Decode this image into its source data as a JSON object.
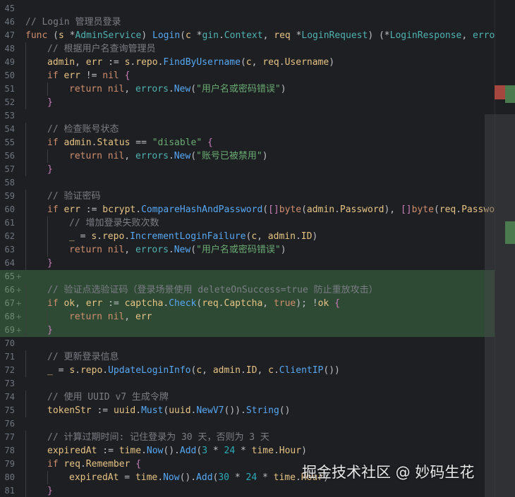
{
  "editor": {
    "lines": [
      {
        "n": "45",
        "added": false,
        "indent": 0,
        "t": []
      },
      {
        "n": "46",
        "added": false,
        "indent": 0,
        "t": [
          [
            "cm",
            "// Login 管理员登录"
          ]
        ]
      },
      {
        "n": "47",
        "added": false,
        "indent": 0,
        "t": [
          [
            "kw",
            "func"
          ],
          [
            "op",
            " ("
          ],
          [
            "vr",
            "s"
          ],
          [
            "op",
            " *"
          ],
          [
            "ty",
            "AdminService"
          ],
          [
            "op",
            ") "
          ],
          [
            "fn",
            "Login"
          ],
          [
            "op",
            "("
          ],
          [
            "vr",
            "c"
          ],
          [
            "op",
            " *"
          ],
          [
            "ty",
            "gin"
          ],
          [
            "op",
            "."
          ],
          [
            "ty",
            "Context"
          ],
          [
            "op",
            ", "
          ],
          [
            "vr",
            "req"
          ],
          [
            "op",
            " *"
          ],
          [
            "ty",
            "LoginRequest"
          ],
          [
            "op",
            ") (*"
          ],
          [
            "ty",
            "LoginResponse"
          ],
          [
            "op",
            ", "
          ],
          [
            "ty",
            "error"
          ],
          [
            "op",
            ")"
          ]
        ]
      },
      {
        "n": "48",
        "added": false,
        "indent": 1,
        "t": [
          [
            "cm",
            "// 根据用户名查询管理员"
          ]
        ]
      },
      {
        "n": "49",
        "added": false,
        "indent": 1,
        "t": [
          [
            "vr",
            "admin"
          ],
          [
            "op",
            ", "
          ],
          [
            "vr",
            "err"
          ],
          [
            "op",
            " := "
          ],
          [
            "vr",
            "s"
          ],
          [
            "op",
            "."
          ],
          [
            "vr",
            "repo"
          ],
          [
            "op",
            "."
          ],
          [
            "fn",
            "FindByUsername"
          ],
          [
            "op",
            "("
          ],
          [
            "vr",
            "c"
          ],
          [
            "op",
            ", "
          ],
          [
            "vr",
            "req"
          ],
          [
            "op",
            "."
          ],
          [
            "vr",
            "Username"
          ],
          [
            "op",
            ")"
          ]
        ]
      },
      {
        "n": "50",
        "added": false,
        "indent": 1,
        "t": [
          [
            "kw",
            "if"
          ],
          [
            "op",
            " "
          ],
          [
            "vr",
            "err"
          ],
          [
            "op",
            " != "
          ],
          [
            "kw",
            "nil"
          ],
          [
            "op",
            " "
          ],
          [
            "pr",
            "{"
          ]
        ]
      },
      {
        "n": "51",
        "added": false,
        "indent": 2,
        "t": [
          [
            "kw",
            "return"
          ],
          [
            "op",
            " "
          ],
          [
            "kw",
            "nil"
          ],
          [
            "op",
            ", "
          ],
          [
            "ty",
            "errors"
          ],
          [
            "op",
            "."
          ],
          [
            "fn",
            "New"
          ],
          [
            "op",
            "("
          ],
          [
            "str",
            "\"用户名或密码错误\""
          ],
          [
            "op",
            ")"
          ]
        ]
      },
      {
        "n": "52",
        "added": false,
        "indent": 1,
        "t": [
          [
            "pr",
            "}"
          ]
        ]
      },
      {
        "n": "53",
        "added": false,
        "indent": 0,
        "t": []
      },
      {
        "n": "54",
        "added": false,
        "indent": 1,
        "t": [
          [
            "cm",
            "// 检查账号状态"
          ]
        ]
      },
      {
        "n": "55",
        "added": false,
        "indent": 1,
        "t": [
          [
            "kw",
            "if"
          ],
          [
            "op",
            " "
          ],
          [
            "vr",
            "admin"
          ],
          [
            "op",
            "."
          ],
          [
            "vr",
            "Status"
          ],
          [
            "op",
            " == "
          ],
          [
            "str",
            "\"disable\""
          ],
          [
            "op",
            " "
          ],
          [
            "pr",
            "{"
          ]
        ]
      },
      {
        "n": "56",
        "added": false,
        "indent": 2,
        "t": [
          [
            "kw",
            "return"
          ],
          [
            "op",
            " "
          ],
          [
            "kw",
            "nil"
          ],
          [
            "op",
            ", "
          ],
          [
            "ty",
            "errors"
          ],
          [
            "op",
            "."
          ],
          [
            "fn",
            "New"
          ],
          [
            "op",
            "("
          ],
          [
            "str",
            "\"账号已被禁用\""
          ],
          [
            "op",
            ")"
          ]
        ]
      },
      {
        "n": "57",
        "added": false,
        "indent": 1,
        "t": [
          [
            "pr",
            "}"
          ]
        ]
      },
      {
        "n": "58",
        "added": false,
        "indent": 0,
        "t": []
      },
      {
        "n": "59",
        "added": false,
        "indent": 1,
        "t": [
          [
            "cm",
            "// 验证密码"
          ]
        ]
      },
      {
        "n": "60",
        "added": false,
        "indent": 1,
        "t": [
          [
            "kw",
            "if"
          ],
          [
            "op",
            " "
          ],
          [
            "vr",
            "err"
          ],
          [
            "op",
            " := "
          ],
          [
            "vr",
            "bcrypt"
          ],
          [
            "op",
            "."
          ],
          [
            "fn",
            "CompareHashAndPassword"
          ],
          [
            "op",
            "("
          ],
          [
            "pr",
            "[]"
          ],
          [
            "kw",
            "byte"
          ],
          [
            "op",
            "("
          ],
          [
            "vr",
            "admin"
          ],
          [
            "op",
            "."
          ],
          [
            "vr",
            "Password"
          ],
          [
            "op",
            "), "
          ],
          [
            "pr",
            "[]"
          ],
          [
            "kw",
            "byte"
          ],
          [
            "op",
            "("
          ],
          [
            "vr",
            "req"
          ],
          [
            "op",
            "."
          ],
          [
            "vr",
            "Password"
          ],
          [
            "op",
            "))"
          ]
        ]
      },
      {
        "n": "61",
        "added": false,
        "indent": 2,
        "t": [
          [
            "cm",
            "// 增加登录失败次数"
          ]
        ]
      },
      {
        "n": "62",
        "added": false,
        "indent": 2,
        "t": [
          [
            "vr",
            "_"
          ],
          [
            "op",
            " = "
          ],
          [
            "vr",
            "s"
          ],
          [
            "op",
            "."
          ],
          [
            "vr",
            "repo"
          ],
          [
            "op",
            "."
          ],
          [
            "fn",
            "IncrementLoginFailure"
          ],
          [
            "op",
            "("
          ],
          [
            "vr",
            "c"
          ],
          [
            "op",
            ", "
          ],
          [
            "vr",
            "admin"
          ],
          [
            "op",
            "."
          ],
          [
            "vr",
            "ID"
          ],
          [
            "op",
            ")"
          ]
        ]
      },
      {
        "n": "63",
        "added": false,
        "indent": 2,
        "t": [
          [
            "kw",
            "return"
          ],
          [
            "op",
            " "
          ],
          [
            "kw",
            "nil"
          ],
          [
            "op",
            ", "
          ],
          [
            "ty",
            "errors"
          ],
          [
            "op",
            "."
          ],
          [
            "fn",
            "New"
          ],
          [
            "op",
            "("
          ],
          [
            "str",
            "\"用户名或密码错误\""
          ],
          [
            "op",
            ")"
          ]
        ]
      },
      {
        "n": "64",
        "added": false,
        "indent": 1,
        "t": [
          [
            "pr",
            "}"
          ]
        ]
      },
      {
        "n": "65",
        "added": true,
        "indent": 0,
        "t": []
      },
      {
        "n": "66",
        "added": true,
        "indent": 1,
        "t": [
          [
            "cm",
            "// 验证点选验证码（登录场景使用 deleteOnSuccess=true 防止重放攻击）"
          ]
        ]
      },
      {
        "n": "67",
        "added": true,
        "indent": 1,
        "t": [
          [
            "kw",
            "if"
          ],
          [
            "op",
            " "
          ],
          [
            "vr",
            "ok"
          ],
          [
            "op",
            ", "
          ],
          [
            "vr",
            "err"
          ],
          [
            "op",
            " := "
          ],
          [
            "vr",
            "captcha"
          ],
          [
            "op",
            "."
          ],
          [
            "fn",
            "Check"
          ],
          [
            "op",
            "("
          ],
          [
            "vr",
            "req"
          ],
          [
            "op",
            "."
          ],
          [
            "vr",
            "Captcha"
          ],
          [
            "op",
            ", "
          ],
          [
            "kw",
            "true"
          ],
          [
            "op",
            "); !"
          ],
          [
            "vr",
            "ok"
          ],
          [
            "op",
            " "
          ],
          [
            "pr",
            "{"
          ]
        ]
      },
      {
        "n": "68",
        "added": true,
        "indent": 2,
        "t": [
          [
            "kw",
            "return"
          ],
          [
            "op",
            " "
          ],
          [
            "kw",
            "nil"
          ],
          [
            "op",
            ", "
          ],
          [
            "vr",
            "err"
          ]
        ]
      },
      {
        "n": "69",
        "added": true,
        "indent": 1,
        "t": [
          [
            "pr",
            "}"
          ]
        ]
      },
      {
        "n": "70",
        "added": false,
        "indent": 0,
        "t": []
      },
      {
        "n": "71",
        "added": false,
        "indent": 1,
        "t": [
          [
            "cm",
            "// 更新登录信息"
          ]
        ]
      },
      {
        "n": "72",
        "added": false,
        "indent": 1,
        "t": [
          [
            "vr",
            "_"
          ],
          [
            "op",
            " = "
          ],
          [
            "vr",
            "s"
          ],
          [
            "op",
            "."
          ],
          [
            "vr",
            "repo"
          ],
          [
            "op",
            "."
          ],
          [
            "fn",
            "UpdateLoginInfo"
          ],
          [
            "op",
            "("
          ],
          [
            "vr",
            "c"
          ],
          [
            "op",
            ", "
          ],
          [
            "vr",
            "admin"
          ],
          [
            "op",
            "."
          ],
          [
            "vr",
            "ID"
          ],
          [
            "op",
            ", "
          ],
          [
            "vr",
            "c"
          ],
          [
            "op",
            "."
          ],
          [
            "fn",
            "ClientIP"
          ],
          [
            "op",
            "())"
          ]
        ]
      },
      {
        "n": "73",
        "added": false,
        "indent": 0,
        "t": []
      },
      {
        "n": "74",
        "added": false,
        "indent": 1,
        "t": [
          [
            "cm",
            "// 使用 UUID v7 生成令牌"
          ]
        ]
      },
      {
        "n": "75",
        "added": false,
        "indent": 1,
        "t": [
          [
            "vr",
            "tokenStr"
          ],
          [
            "op",
            " := "
          ],
          [
            "vr",
            "uuid"
          ],
          [
            "op",
            "."
          ],
          [
            "fn",
            "Must"
          ],
          [
            "op",
            "("
          ],
          [
            "vr",
            "uuid"
          ],
          [
            "op",
            "."
          ],
          [
            "fn",
            "NewV7"
          ],
          [
            "op",
            "())."
          ],
          [
            "fn",
            "String"
          ],
          [
            "op",
            "()"
          ]
        ]
      },
      {
        "n": "76",
        "added": false,
        "indent": 0,
        "t": []
      },
      {
        "n": "77",
        "added": false,
        "indent": 1,
        "t": [
          [
            "cm",
            "// 计算过期时间: 记住登录为 30 天，否则为 3 天"
          ]
        ]
      },
      {
        "n": "78",
        "added": false,
        "indent": 1,
        "t": [
          [
            "vr",
            "expiredAt"
          ],
          [
            "op",
            " := "
          ],
          [
            "vr",
            "time"
          ],
          [
            "op",
            "."
          ],
          [
            "fn",
            "Now"
          ],
          [
            "op",
            "()."
          ],
          [
            "fn",
            "Add"
          ],
          [
            "op",
            "("
          ],
          [
            "num",
            "3"
          ],
          [
            "op",
            " * "
          ],
          [
            "num",
            "24"
          ],
          [
            "op",
            " * "
          ],
          [
            "vr",
            "time"
          ],
          [
            "op",
            "."
          ],
          [
            "vr",
            "Hour"
          ],
          [
            "op",
            ")"
          ]
        ]
      },
      {
        "n": "79",
        "added": false,
        "indent": 1,
        "t": [
          [
            "kw",
            "if"
          ],
          [
            "op",
            " "
          ],
          [
            "vr",
            "req"
          ],
          [
            "op",
            "."
          ],
          [
            "vr",
            "Remember"
          ],
          [
            "op",
            " "
          ],
          [
            "pr",
            "{"
          ]
        ]
      },
      {
        "n": "80",
        "added": false,
        "indent": 2,
        "t": [
          [
            "vr",
            "expiredAt"
          ],
          [
            "op",
            " = "
          ],
          [
            "vr",
            "time"
          ],
          [
            "op",
            "."
          ],
          [
            "fn",
            "Now"
          ],
          [
            "op",
            "()."
          ],
          [
            "fn",
            "Add"
          ],
          [
            "op",
            "("
          ],
          [
            "num",
            "30"
          ],
          [
            "op",
            " * "
          ],
          [
            "num",
            "24"
          ],
          [
            "op",
            " * "
          ],
          [
            "vr",
            "time"
          ],
          [
            "op",
            "."
          ],
          [
            "vr",
            "Hour"
          ],
          [
            "op",
            ")"
          ]
        ]
      },
      {
        "n": "81",
        "added": false,
        "indent": 1,
        "t": [
          [
            "pr",
            "}"
          ]
        ]
      }
    ]
  },
  "watermark": "掘金技术社区 @ 妙码生花"
}
